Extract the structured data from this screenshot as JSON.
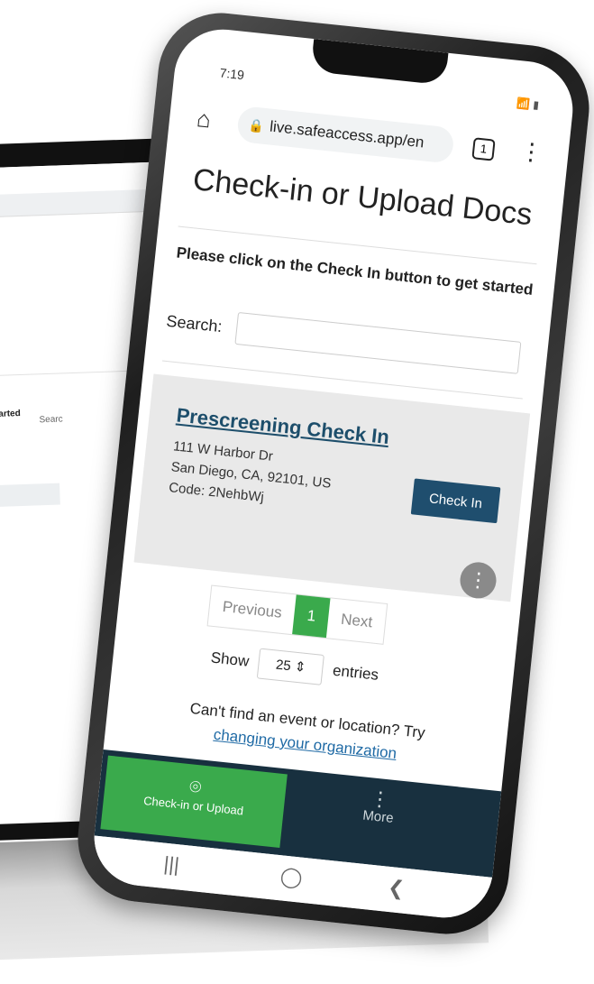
{
  "background_laptop": {
    "text_fragment": "t started",
    "search_fragment": "Searc"
  },
  "status_bar": {
    "time": "7:19",
    "icons": "📶 ▮"
  },
  "browser": {
    "url": "live.safeaccess.app/en",
    "tab_count": "1",
    "home_icon": "home-icon",
    "menu_icon": "kebab-menu-icon"
  },
  "page": {
    "title": "Check-in or Upload Docs",
    "instruction": "Please click on the Check In button to get started",
    "search_label": "Search:",
    "search_value": ""
  },
  "event_card": {
    "title": "Prescreening Check In",
    "address_line1": "111 W Harbor Dr",
    "address_line2": "San Diego, CA, 92101, US",
    "code": "Code: 2NehbWj",
    "button_label": "Check In"
  },
  "pagination": {
    "previous": "Previous",
    "current_page": "1",
    "next": "Next"
  },
  "entries": {
    "show_label": "Show",
    "selected": "25",
    "entries_label": "entries"
  },
  "help": {
    "text": "Can't find an event or location? Try",
    "link": "changing your organization"
  },
  "bottom_nav": {
    "checkin_label": "Check-in or Upload",
    "more_label": "More"
  },
  "colors": {
    "primary_dark": "#1f4e6e",
    "accent_green": "#3aaa4c",
    "nav_bg": "#18303f",
    "link": "#1f6aa5"
  }
}
